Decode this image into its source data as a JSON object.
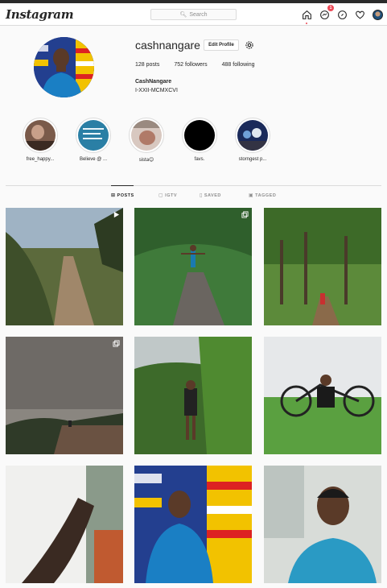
{
  "nav": {
    "logo": "Instagram",
    "search_placeholder": "Search",
    "direct_badge_count": "1"
  },
  "profile": {
    "username": "cashnangare",
    "edit_profile_label": "Edit Profile",
    "posts_count": "128",
    "posts_label": "posts",
    "followers_count": "752",
    "followers_label": "followers",
    "following_count": "488",
    "following_label": "following",
    "full_name": "CashNangare",
    "bio": "I-XXII-MCMXCVI"
  },
  "highlights": [
    {
      "label": "free_happy..."
    },
    {
      "label": "Believe @ ..."
    },
    {
      "label": "sista😊"
    },
    {
      "label": "favs."
    },
    {
      "label": "storngest p..."
    }
  ],
  "tabs": [
    {
      "label": "POSTS",
      "icon": "grid-icon",
      "active": true
    },
    {
      "label": "IGTV",
      "icon": "tv-icon",
      "active": false
    },
    {
      "label": "SAVED",
      "icon": "bookmark-icon",
      "active": false
    },
    {
      "label": "TAGGED",
      "icon": "tag-icon",
      "active": false
    }
  ],
  "posts": [
    {
      "type": "video"
    },
    {
      "type": "carousel"
    },
    {
      "type": "photo"
    },
    {
      "type": "carousel"
    },
    {
      "type": "photo"
    },
    {
      "type": "photo"
    },
    {
      "type": "photo"
    },
    {
      "type": "photo"
    },
    {
      "type": "photo"
    }
  ],
  "colors": {
    "accent_red": "#ed4956",
    "text": "#262626",
    "muted": "#8e8e8e",
    "border": "#dbdbdb",
    "background": "#fafafa"
  }
}
